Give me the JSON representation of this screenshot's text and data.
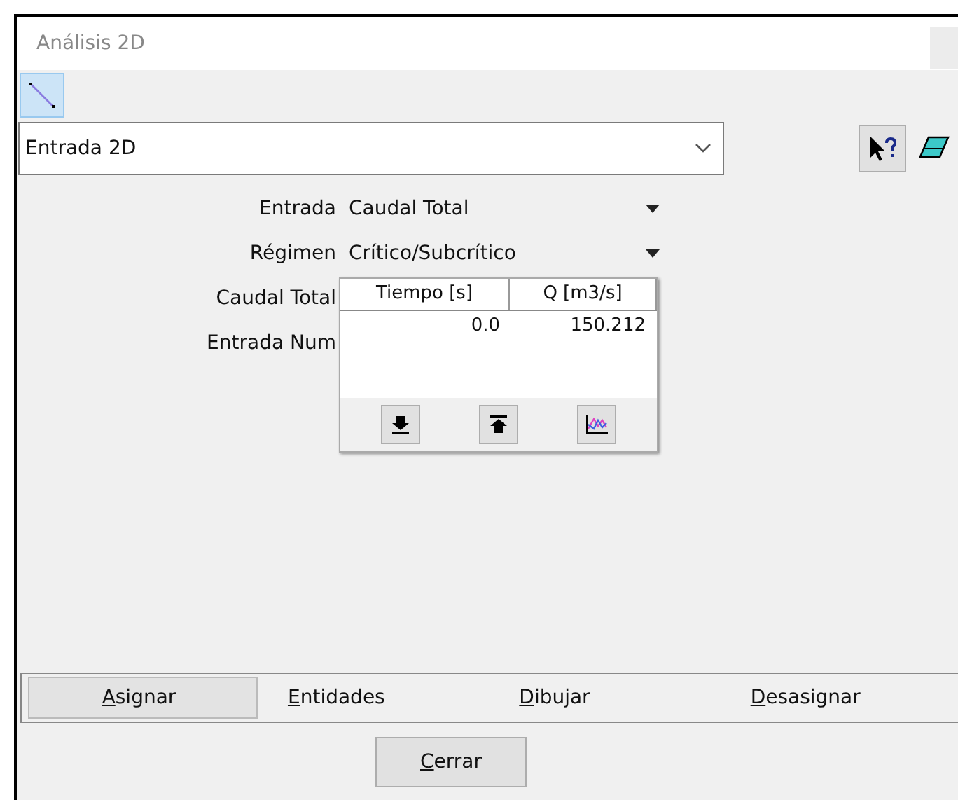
{
  "window": {
    "title": "Análisis 2D"
  },
  "toolbar": {
    "line_tool_selected": true
  },
  "combo": {
    "value": "Entrada 2D"
  },
  "form": [
    {
      "label": "Entrada",
      "kind": "dropdown",
      "value": "Caudal Total"
    },
    {
      "label": "Régimen",
      "kind": "dropdown",
      "value": "Crítico/Subcrítico"
    },
    {
      "label": "Caudal Total",
      "kind": "label"
    },
    {
      "label": "Entrada Num",
      "kind": "label"
    }
  ],
  "table": {
    "columns": [
      "Tiempo [s]",
      "Q [m3/s]"
    ],
    "rows": [
      [
        "0.0",
        "150.212"
      ]
    ]
  },
  "tabs": [
    {
      "label": "Asignar",
      "selected": true
    },
    {
      "label": "Entidades",
      "selected": false
    },
    {
      "label": "Dibujar",
      "selected": false
    },
    {
      "label": "Desasignar",
      "selected": false
    }
  ],
  "buttons": [
    "Cerrar"
  ]
}
